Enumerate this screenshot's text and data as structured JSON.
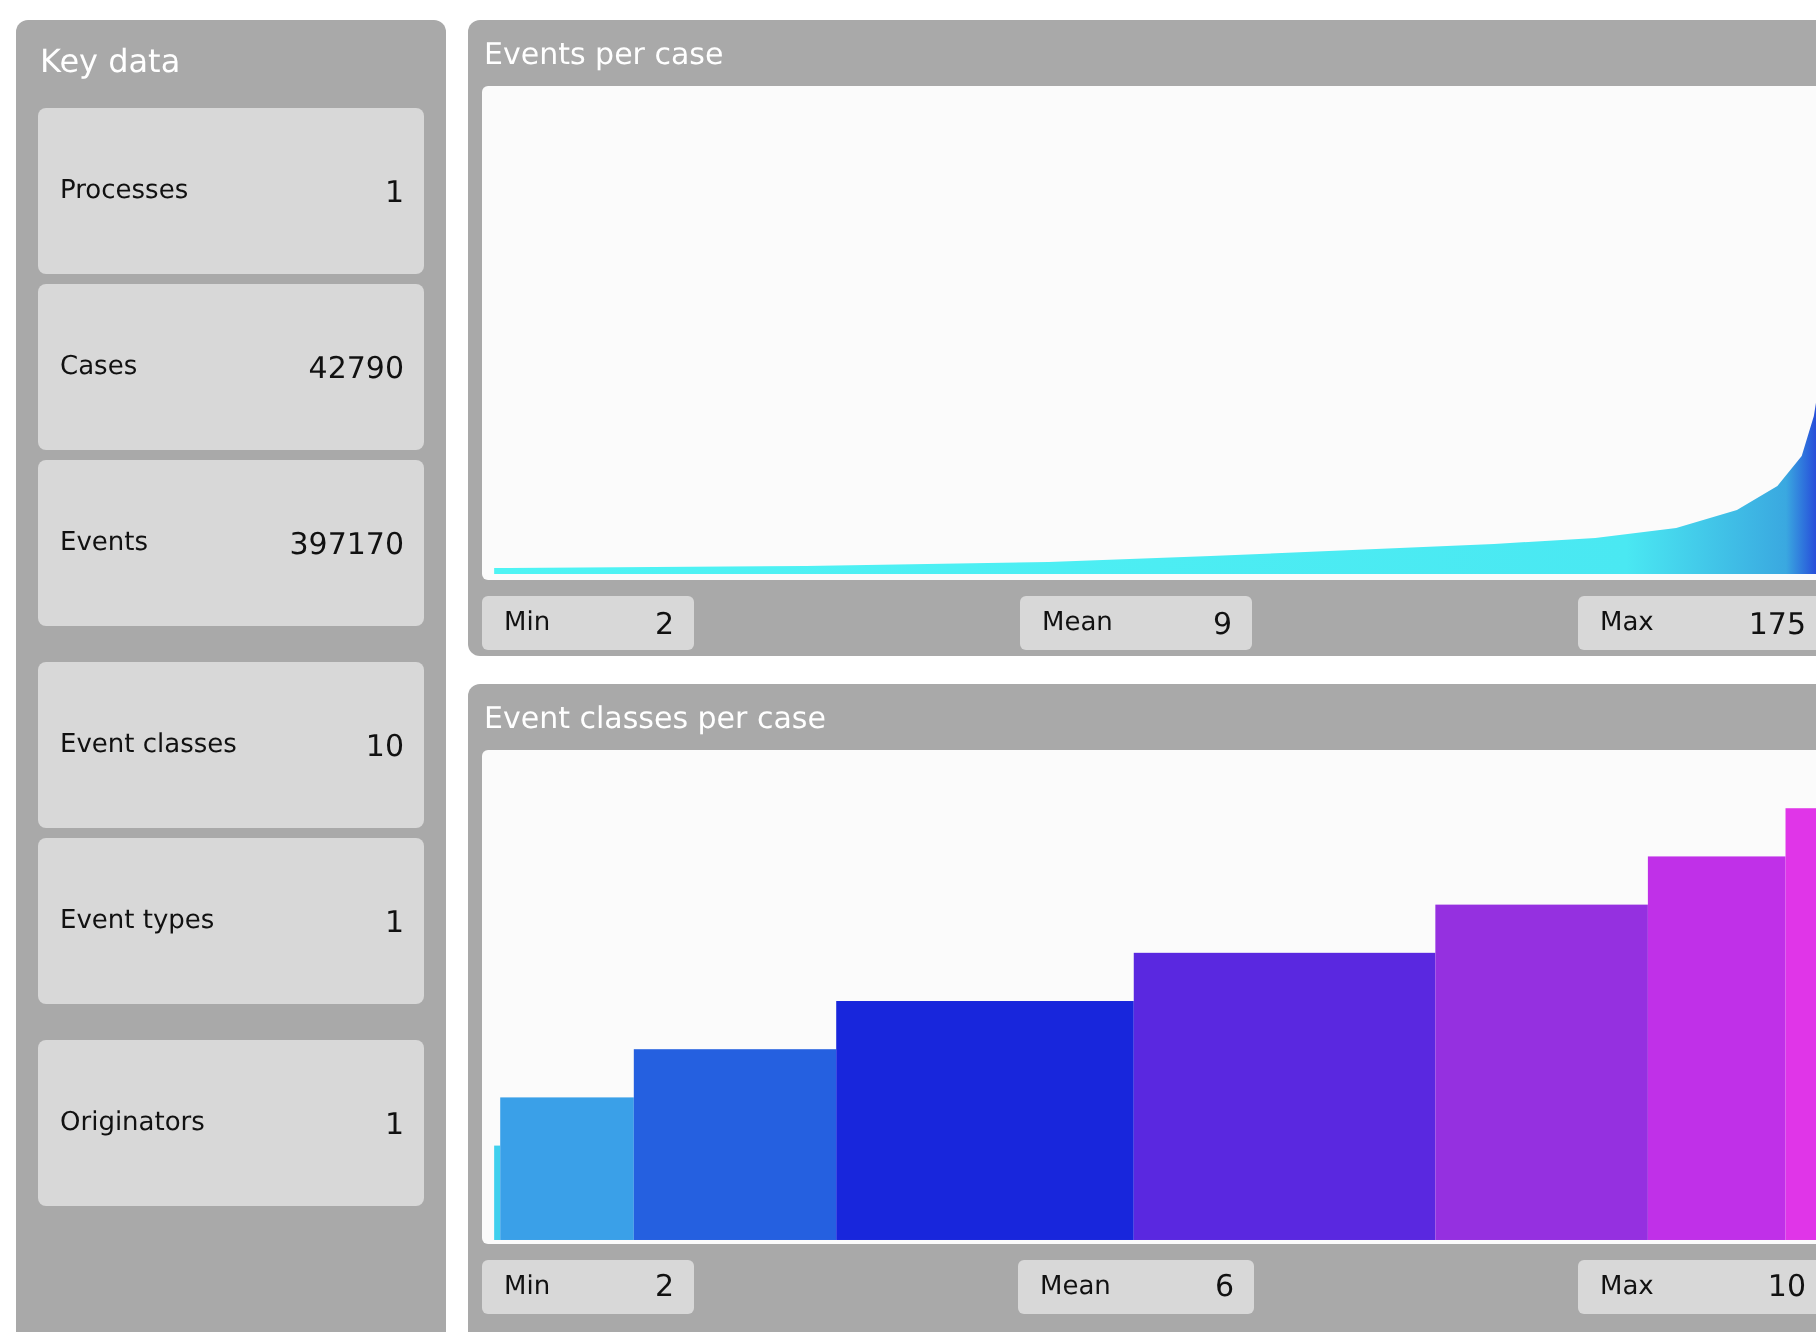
{
  "key_data": {
    "title": "Key data",
    "groups": [
      [
        {
          "label": "Processes",
          "value": "1"
        },
        {
          "label": "Cases",
          "value": "42790"
        },
        {
          "label": "Events",
          "value": "397170"
        }
      ],
      [
        {
          "label": "Event classes",
          "value": "10"
        },
        {
          "label": "Event types",
          "value": "1"
        }
      ],
      [
        {
          "label": "Originators",
          "value": "1"
        }
      ]
    ]
  },
  "panels": [
    {
      "title": "Events per case",
      "kind": "curve",
      "stats": [
        {
          "label": "Min",
          "value": "2"
        },
        {
          "label": "Mean",
          "value": "9"
        },
        {
          "label": "Max",
          "value": "175"
        }
      ]
    },
    {
      "title": "Event classes per case",
      "kind": "steps",
      "stats": [
        {
          "label": "Min",
          "value": "2"
        },
        {
          "label": "Mean",
          "value": "6"
        },
        {
          "label": "Max",
          "value": "10"
        }
      ]
    }
  ]
}
